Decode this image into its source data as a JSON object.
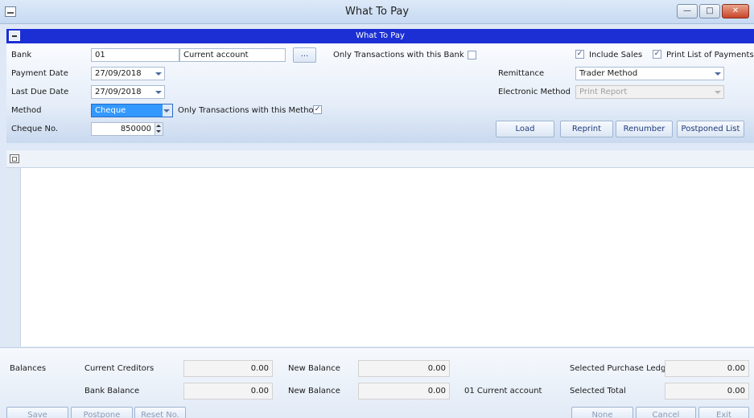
{
  "window": {
    "title": "What To Pay"
  },
  "panel": {
    "title": "What To Pay"
  },
  "form": {
    "bank_label": "Bank",
    "bank_code": "01",
    "bank_name": "Current account",
    "bank_lookup": "...",
    "only_bank_label": "Only Transactions with this Bank",
    "only_bank_checked": false,
    "payment_date_label": "Payment Date",
    "payment_date": "27/09/2018",
    "last_due_label": "Last Due Date",
    "last_due": "27/09/2018",
    "method_label": "Method",
    "method": "Cheque",
    "only_method_label": "Only Transactions with this Method",
    "only_method_checked": true,
    "cheque_label": "Cheque No.",
    "cheque_no": "850000",
    "include_sales_label": "Include Sales",
    "include_sales_checked": true,
    "print_list_label": "Print List of Payments",
    "print_list_checked": true,
    "remittance_label": "Remittance",
    "remittance": "Trader Method",
    "electronic_label": "Electronic Method",
    "electronic": "Print Report",
    "buttons": {
      "load": "Load",
      "reprint": "Reprint",
      "renumber": "Renumber",
      "postponed": "Postponed List"
    }
  },
  "footer": {
    "balances_label": "Balances",
    "current_creditors_label": "Current Creditors",
    "current_creditors": "0.00",
    "new_balance_label_1": "New Balance",
    "new_balance_1": "0.00",
    "selected_pl_label": "Selected Purchase Ledger",
    "selected_pl": "0.00",
    "bank_balance_label": "Bank Balance",
    "bank_balance": "0.00",
    "new_balance_label_2": "New Balance",
    "new_balance_2": "0.00",
    "account_label": "01  Current account",
    "selected_total_label": "Selected Total",
    "selected_total": "0.00",
    "buttons": {
      "save": "Save",
      "postpone": "Postpone",
      "reset": "Reset No.",
      "none": "None",
      "cancel": "Cancel",
      "exit": "Exit"
    }
  }
}
